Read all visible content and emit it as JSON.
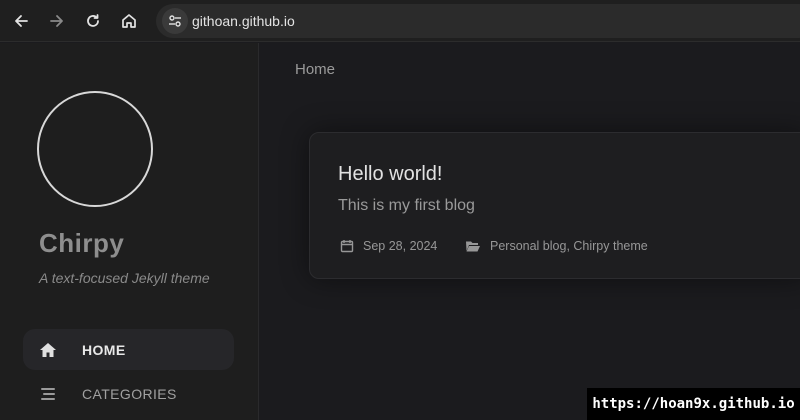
{
  "browser": {
    "url": "githoan.github.io"
  },
  "sidebar": {
    "title": "Chirpy",
    "subtitle": "A text-focused Jekyll theme",
    "items": [
      {
        "label": "HOME",
        "icon": "home-icon",
        "active": true
      },
      {
        "label": "CATEGORIES",
        "icon": "stream-icon",
        "active": false
      }
    ]
  },
  "main": {
    "breadcrumb": "Home",
    "posts": [
      {
        "title": "Hello world!",
        "excerpt": "This is my first blog",
        "date": "Sep 28, 2024",
        "categories": "Personal blog, Chirpy theme"
      }
    ]
  },
  "watermark": "https://hoan9x.github.io",
  "colors": {
    "background": "#1b1b1e",
    "sidebar": "#1e1e1e",
    "browser_bar": "#1f1f1f",
    "card": "#1e1e20"
  }
}
